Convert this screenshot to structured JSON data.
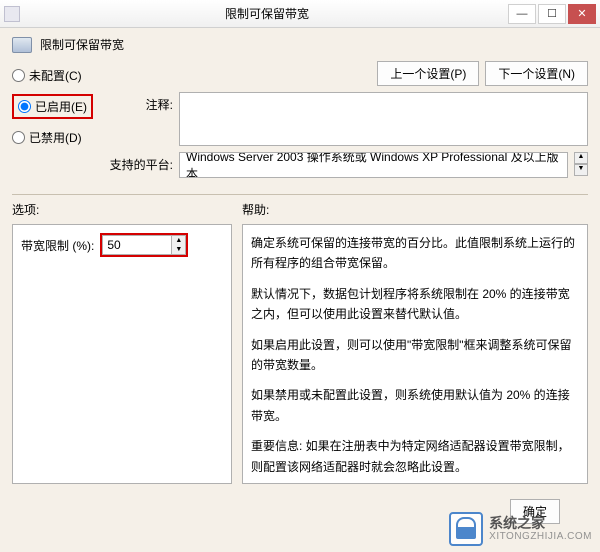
{
  "window": {
    "title": "限制可保留带宽"
  },
  "policy": {
    "name": "限制可保留带宽"
  },
  "nav": {
    "prev": "上一个设置(P)",
    "next": "下一个设置(N)"
  },
  "radios": {
    "not_configured": "未配置(C)",
    "enabled": "已启用(E)",
    "disabled": "已禁用(D)",
    "selected": "enabled"
  },
  "fields": {
    "comment_label": "注释:",
    "comment_value": "",
    "platform_label": "支持的平台:",
    "platform_value": "Windows Server 2003 操作系统或 Windows XP Professional 及以上版本"
  },
  "sections": {
    "options_label": "选项:",
    "help_label": "帮助:"
  },
  "option": {
    "bandwidth_label": "带宽限制 (%):",
    "bandwidth_value": "50"
  },
  "help": {
    "p1": "确定系统可保留的连接带宽的百分比。此值限制系统上运行的所有程序的组合带宽保留。",
    "p2": "默认情况下，数据包计划程序将系统限制在 20% 的连接带宽之内，但可以使用此设置来替代默认值。",
    "p3": "如果启用此设置，则可以使用\"带宽限制\"框来调整系统可保留的带宽数量。",
    "p4": "如果禁用或未配置此设置，则系统使用默认值为 20% 的连接带宽。",
    "p5": "重要信息: 如果在注册表中为特定网络适配器设置带宽限制，则配置该网络适配器时就会忽略此设置。"
  },
  "buttons": {
    "ok": "确定"
  },
  "watermark": {
    "name": "系统之家",
    "url": "XITONGZHIJIA.COM"
  }
}
